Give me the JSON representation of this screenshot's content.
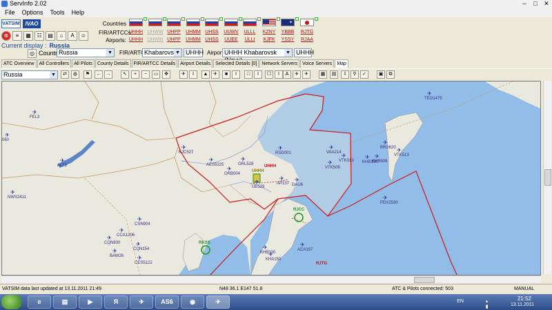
{
  "window": {
    "title": "ServInfo 2.02"
  },
  "menu": [
    "File",
    "Options",
    "Tools",
    "Help"
  ],
  "logos": {
    "vatsim": "VATSIM",
    "ivao": "IVAO"
  },
  "current_display": {
    "label": "Current display :",
    "value": "Russia"
  },
  "country": {
    "label": "Country:",
    "value": "Russia"
  },
  "fir": {
    "label": "FIR/ARTCC:",
    "value": "Khabarovsk",
    "code": "UHHH"
  },
  "airport": {
    "label": "Airport:",
    "value": "UHHH Khabarovsk (Novy)",
    "code": "UHHH"
  },
  "countries_row_label": "Countries",
  "fir_row_label": "FIR/ARTCCs:",
  "airports_row_label": "Airports:",
  "flags": [
    {
      "country": "russia",
      "fir": "UHHH",
      "airport": "UHHH",
      "dim": false
    },
    {
      "country": "russia",
      "fir": "UHWW",
      "airport": "UHWW",
      "dim": true
    },
    {
      "country": "russia",
      "fir": "UHPP",
      "airport": "UHPP",
      "dim": false
    },
    {
      "country": "russia",
      "fir": "UHMM",
      "airport": "UHMM",
      "dim": false
    },
    {
      "country": "russia",
      "fir": "UHSS",
      "airport": "UHSS",
      "dim": false
    },
    {
      "country": "russia",
      "fir": "UUWV",
      "airport": "UUEE",
      "dim": false
    },
    {
      "country": "russia",
      "fir": "ULLL",
      "airport": "ULLI",
      "dim": false
    },
    {
      "country": "usa",
      "fir": "KZNY",
      "airport": "KJFK",
      "dim": false
    },
    {
      "country": "australia",
      "fir": "YBBB",
      "airport": "YSSY",
      "dim": false
    },
    {
      "country": "japan",
      "fir": "RJTG",
      "airport": "RJAA",
      "dim": false
    }
  ],
  "tabs": [
    "ATC Overview",
    "All Controllers",
    "All Pilots",
    "County Details",
    "FIR/ARTCC Details",
    "Airport Details",
    "Selected Details [0]",
    "Network Servers",
    "Voice Servers",
    "Map"
  ],
  "active_tab": "Map",
  "map_toolbar": {
    "region": "Russia"
  },
  "map_labels": {
    "firs": [
      {
        "text": "UHHH"
      },
      {
        "text": "RJTG"
      }
    ],
    "stations": [
      {
        "text": "UHHH"
      },
      {
        "text": "RJCC"
      },
      {
        "text": "RKSS"
      }
    ],
    "aircraft": [
      "FEL3",
      "ALT3",
      "NWS2411",
      "KJC527",
      "AES5225",
      "GRL528",
      "ORB004",
      "RSD001",
      "VAA214",
      "VTK313",
      "VTK509",
      "UE529",
      "AP137",
      "DAU6",
      "TEO1475",
      "BRU620",
      "KHB106",
      "KHB508",
      "VTK513",
      "PDX2530",
      "CSN904",
      "CCA1206",
      "CQN830",
      "CQN154",
      "BAW26",
      "CES5122",
      "KHB330",
      "ACA197",
      "KHA150",
      "060"
    ]
  },
  "status": {
    "updated": "VATSIM data last updated at 13.11.2011 21:49",
    "coords": "N48 36.1  E147 51.8",
    "connected": "ATC & Pilots connected: 503",
    "mode": "MANUAL"
  },
  "taskbar": {
    "lang": "EN",
    "time": "21:52",
    "date": "13.11.2011",
    "as6": "AS6"
  },
  "colors": {
    "sea": "#92bde8",
    "land": "#eae9df",
    "fir_boundary": "#d01818",
    "aircraft": "#1b2d8a"
  }
}
